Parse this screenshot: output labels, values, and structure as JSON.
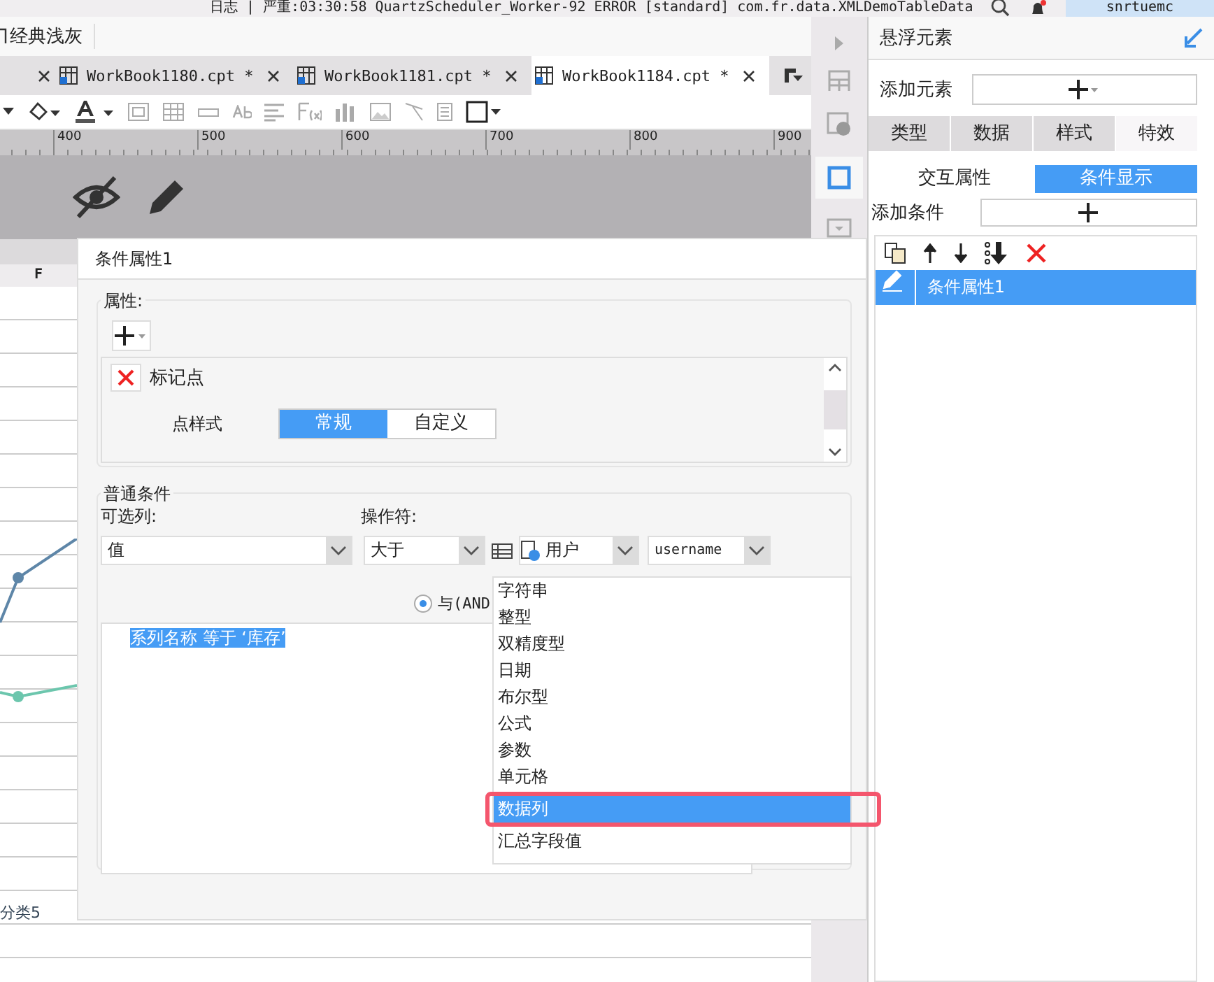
{
  "log_bar": {
    "message": "日志 | 严重:03:30:58 QuartzScheduler_Worker-92 ERROR [standard] com.fr.data.XMLDemoTableData",
    "user": "snrtuemc"
  },
  "theme": {
    "label": "经典浅灰"
  },
  "tabs": [
    {
      "label": "WorkBook1180.cpt *",
      "selected": false
    },
    {
      "label": "WorkBook1181.cpt *",
      "selected": false
    },
    {
      "label": "WorkBook1184.cpt *",
      "selected": true
    }
  ],
  "ruler": {
    "ticks": [
      "400",
      "500",
      "600",
      "700",
      "800",
      "900"
    ]
  },
  "sheet": {
    "column_header": "F",
    "category_label": "分类5"
  },
  "dialog": {
    "title": "条件属性1",
    "properties": {
      "title": "属性:",
      "item": "标记点",
      "style_label": "点样式",
      "style_options": [
        {
          "label": "常规",
          "selected": true
        },
        {
          "label": "自定义",
          "selected": false
        }
      ]
    },
    "condition": {
      "title": "普通条件",
      "column_label": "可选列:",
      "column_value": "值",
      "operator_label": "操作符:",
      "operator_value": "大于",
      "value_type": "用户",
      "value": "username",
      "logic": {
        "label": "与(AND",
        "selected": true
      },
      "conditions": [
        {
          "text": "系列名称 等于 ‘库存’",
          "selected": true
        }
      ]
    }
  },
  "type_menu": {
    "items": [
      {
        "label": "字符串",
        "selected": false
      },
      {
        "label": "整型",
        "selected": false
      },
      {
        "label": "双精度型",
        "selected": false
      },
      {
        "label": "日期",
        "selected": false
      },
      {
        "label": "布尔型",
        "selected": false
      },
      {
        "label": "公式",
        "selected": false
      },
      {
        "label": "参数",
        "selected": false
      },
      {
        "label": "单元格",
        "selected": false
      },
      {
        "label": "数据列",
        "selected": true
      },
      {
        "label": "汇总字段值",
        "selected": false
      }
    ]
  },
  "panel": {
    "title": "悬浮元素",
    "add_element_label": "添加元素",
    "tabs": [
      {
        "label": "类型",
        "selected": false
      },
      {
        "label": "数据",
        "selected": false
      },
      {
        "label": "样式",
        "selected": false
      },
      {
        "label": "特效",
        "selected": true
      }
    ],
    "subtabs": [
      {
        "label": "交互属性",
        "selected": false
      },
      {
        "label": "条件显示",
        "selected": true
      }
    ],
    "add_condition_label": "添加条件",
    "conditions": [
      {
        "label": "条件属性1",
        "selected": true
      }
    ]
  }
}
